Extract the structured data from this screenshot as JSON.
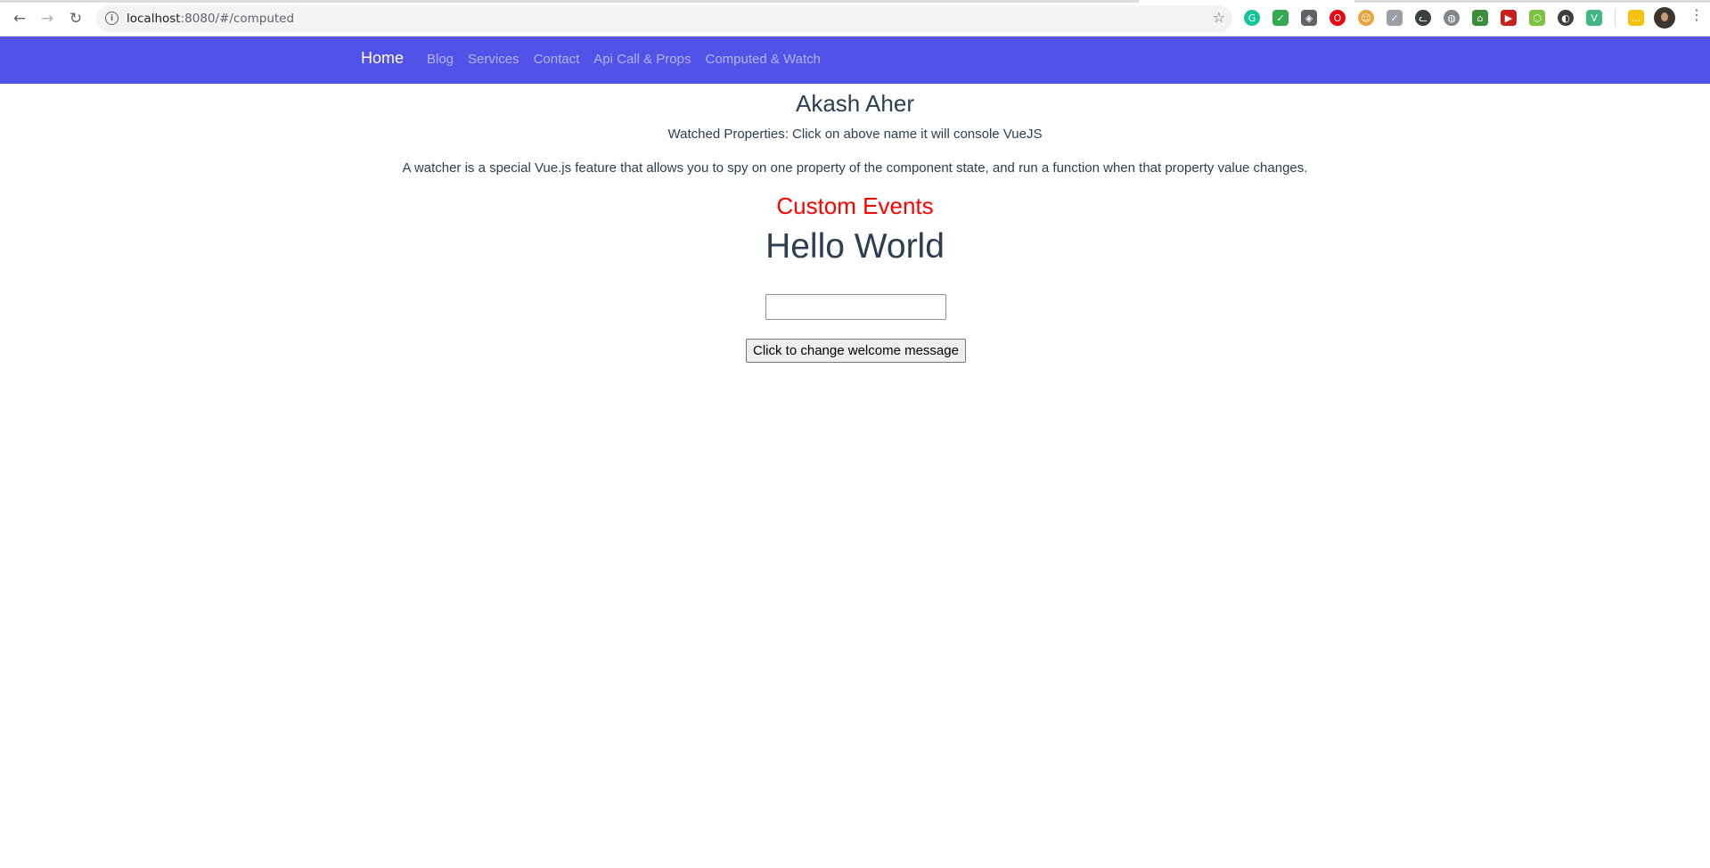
{
  "browser": {
    "url_host": "localhost",
    "url_rest": ":8080/#/computed",
    "back_icon": "←",
    "forward_icon": "→",
    "reload_icon": "↻",
    "info_icon": "i",
    "star_icon": "☆",
    "menu_icon": "⋮",
    "extensions": [
      {
        "name": "grammarly-icon",
        "color": "#15c39a",
        "glyph": "G",
        "round": true
      },
      {
        "name": "save-icon",
        "color": "#34a853",
        "glyph": "✓",
        "round": false
      },
      {
        "name": "shield-icon",
        "color": "#5f6368",
        "glyph": "◈",
        "round": false
      },
      {
        "name": "opera-icon",
        "color": "#e50914",
        "glyph": "O",
        "round": true
      },
      {
        "name": "emoji-icon",
        "color": "#e8a33c",
        "glyph": "☺",
        "round": true
      },
      {
        "name": "check-icon",
        "color": "#9aa0a6",
        "glyph": "✓",
        "round": false
      },
      {
        "name": "cat-icon",
        "color": "#3c4043",
        "glyph": "ᓚ",
        "round": true
      },
      {
        "name": "globe-icon",
        "color": "#80868b",
        "glyph": "◍",
        "round": true
      },
      {
        "name": "tag-icon",
        "color": "#3c8c3c",
        "glyph": "⌂",
        "round": false
      },
      {
        "name": "play-icon",
        "color": "#c5221f",
        "glyph": "▶",
        "round": false
      },
      {
        "name": "node-icon",
        "color": "#7cc242",
        "glyph": "⬡",
        "round": false
      },
      {
        "name": "moon-icon",
        "color": "#3c4043",
        "glyph": "◐",
        "round": true
      },
      {
        "name": "vue-icon",
        "color": "#41b883",
        "glyph": "V",
        "round": false
      },
      {
        "name": "chat-icon",
        "color": "#f4c20d",
        "glyph": "…",
        "round": false
      }
    ]
  },
  "nav": {
    "brand": "Home",
    "links": [
      "Blog",
      "Services",
      "Contact",
      "Api Call & Props",
      "Computed & Watch"
    ]
  },
  "main": {
    "name": "Akash Aher",
    "watched": "Watched Properties: Click on above name it will console VueJS",
    "description": "A watcher is a special Vue.js feature that allows you to spy on one property of the component state, and run a function when that property value changes.",
    "custom_events_heading": "Custom Events",
    "welcome_message": "Hello World",
    "input_value": "",
    "change_button": "Click to change welcome message"
  }
}
